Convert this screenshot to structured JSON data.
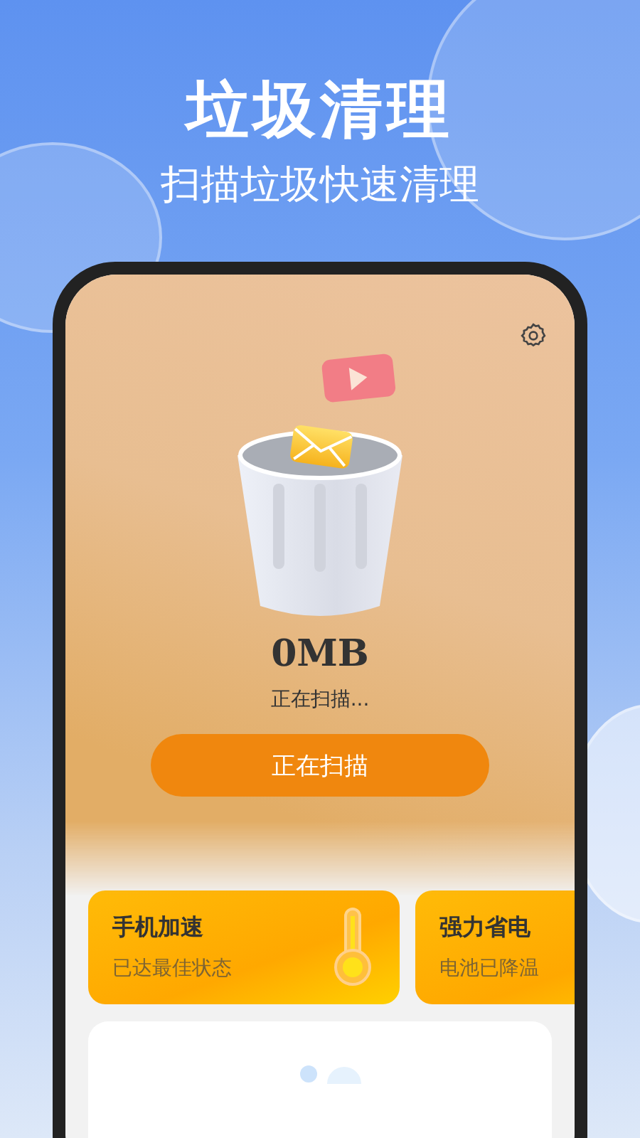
{
  "headline": {
    "title": "垃圾清理",
    "subtitle": "扫描垃圾快速清理"
  },
  "scan": {
    "size": "0MB",
    "status": "正在扫描...",
    "button": "正在扫描"
  },
  "cards": [
    {
      "title": "手机加速",
      "subtitle": "已达最佳状态",
      "kind": "thermometer"
    },
    {
      "title": "强力省电",
      "subtitle": "电池已降温",
      "kind": "plain"
    }
  ]
}
